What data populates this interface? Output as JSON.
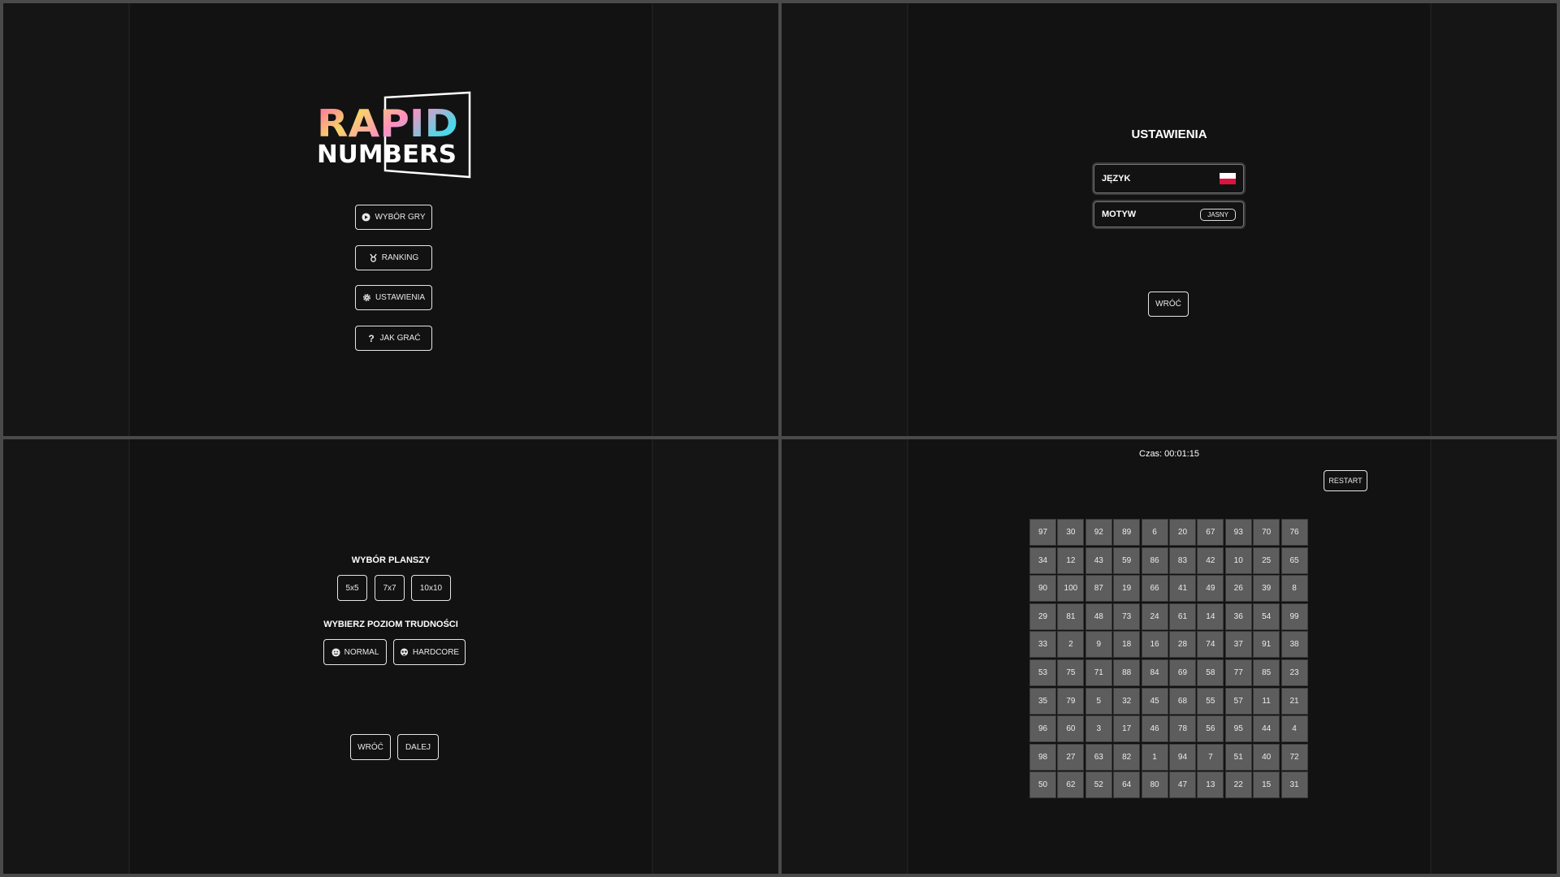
{
  "menu": {
    "logo_line1": "RAPID",
    "logo_line2": "NUMBERS",
    "buttons": [
      {
        "label": "WYBÓR GRY",
        "icon": "play-icon"
      },
      {
        "label": "RANKING",
        "icon": "medal-icon"
      },
      {
        "label": "USTAWIENIA",
        "icon": "gear-icon"
      },
      {
        "label": "JAK GRAĆ",
        "icon": "question-icon"
      }
    ]
  },
  "settings": {
    "title": "USTAWIENIA",
    "language_label": "JĘZYK",
    "language_flag": "poland-flag-icon",
    "theme_label": "MOTYW",
    "theme_value": "JASNY",
    "back_label": "WRÓĆ"
  },
  "game_select": {
    "board_title": "WYBÓR PLANSZY",
    "boards": [
      "5x5",
      "7x7",
      "10x10"
    ],
    "difficulty_title": "WYBIERZ POZIOM TRUDNOŚCI",
    "difficulties": [
      {
        "label": "NORMAL",
        "icon": "smile-icon"
      },
      {
        "label": "HARDCORE",
        "icon": "skull-icon"
      }
    ],
    "back_label": "WRÓĆ",
    "next_label": "DALEJ"
  },
  "game": {
    "timer": "Czas: 00:01:15",
    "restart_label": "RESTART",
    "cells": [
      [
        "97",
        "30",
        "92",
        "89",
        "6",
        "20",
        "67",
        "93",
        "70",
        "76"
      ],
      [
        "34",
        "12",
        "43",
        "59",
        "86",
        "83",
        "42",
        "10",
        "25",
        "65"
      ],
      [
        "90",
        "100",
        "87",
        "19",
        "66",
        "41",
        "49",
        "26",
        "39",
        "8"
      ],
      [
        "29",
        "81",
        "48",
        "73",
        "24",
        "61",
        "14",
        "36",
        "54",
        "99"
      ],
      [
        "33",
        "2",
        "9",
        "18",
        "16",
        "28",
        "74",
        "37",
        "91",
        "38"
      ],
      [
        "53",
        "75",
        "71",
        "88",
        "84",
        "69",
        "58",
        "77",
        "85",
        "23"
      ],
      [
        "35",
        "79",
        "5",
        "32",
        "45",
        "68",
        "55",
        "57",
        "11",
        "21"
      ],
      [
        "96",
        "60",
        "3",
        "17",
        "46",
        "78",
        "56",
        "95",
        "44",
        "4"
      ],
      [
        "98",
        "27",
        "63",
        "82",
        "1",
        "94",
        "7",
        "51",
        "40",
        "72"
      ],
      [
        "50",
        "62",
        "52",
        "64",
        "80",
        "47",
        "13",
        "22",
        "15",
        "31"
      ]
    ]
  },
  "colors": {
    "background": "#121212",
    "cell": "#5d5d5d",
    "flag_red": "#dc143c"
  }
}
